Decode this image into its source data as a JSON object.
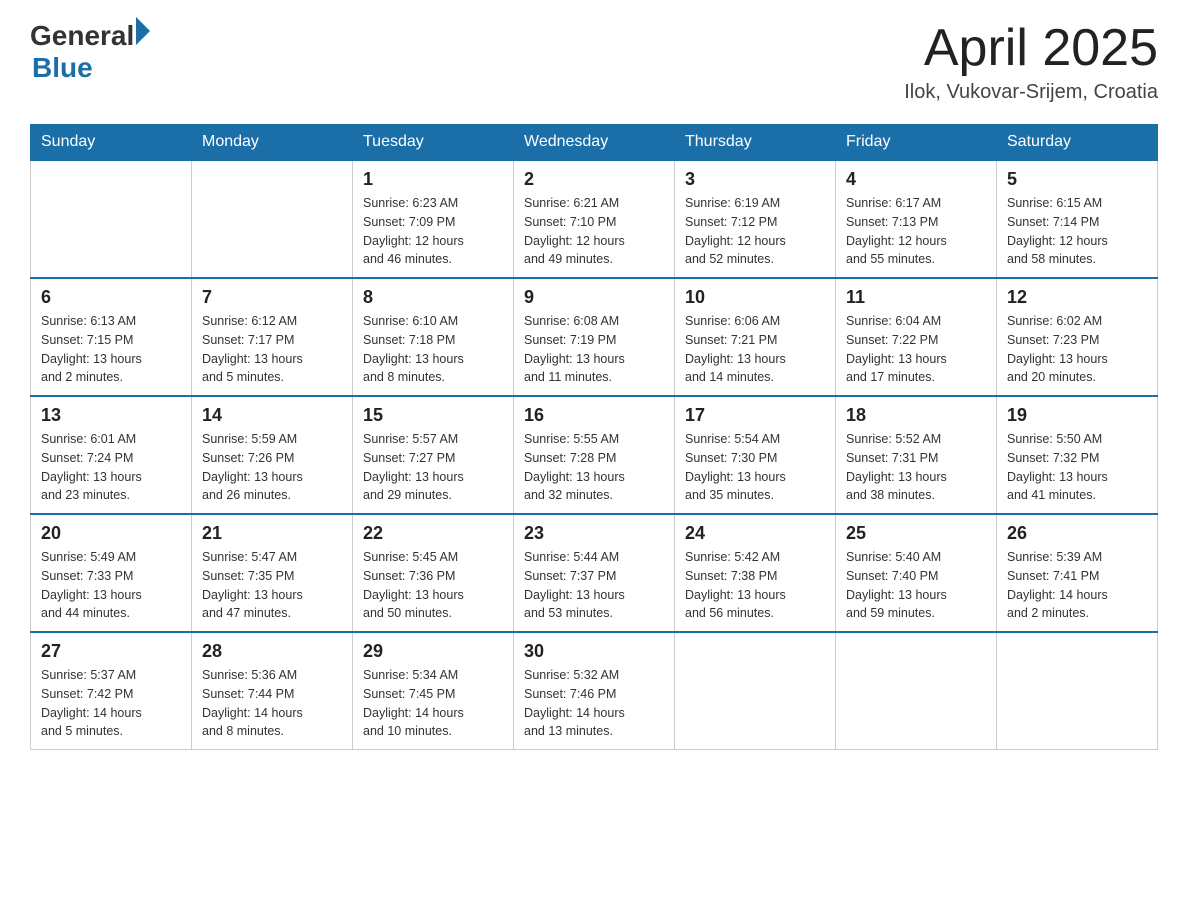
{
  "header": {
    "logo_general": "General",
    "logo_blue": "Blue",
    "title": "April 2025",
    "subtitle": "Ilok, Vukovar-Srijem, Croatia"
  },
  "days_of_week": [
    "Sunday",
    "Monday",
    "Tuesday",
    "Wednesday",
    "Thursday",
    "Friday",
    "Saturday"
  ],
  "weeks": [
    [
      {
        "day": "",
        "info": ""
      },
      {
        "day": "",
        "info": ""
      },
      {
        "day": "1",
        "info": "Sunrise: 6:23 AM\nSunset: 7:09 PM\nDaylight: 12 hours\nand 46 minutes."
      },
      {
        "day": "2",
        "info": "Sunrise: 6:21 AM\nSunset: 7:10 PM\nDaylight: 12 hours\nand 49 minutes."
      },
      {
        "day": "3",
        "info": "Sunrise: 6:19 AM\nSunset: 7:12 PM\nDaylight: 12 hours\nand 52 minutes."
      },
      {
        "day": "4",
        "info": "Sunrise: 6:17 AM\nSunset: 7:13 PM\nDaylight: 12 hours\nand 55 minutes."
      },
      {
        "day": "5",
        "info": "Sunrise: 6:15 AM\nSunset: 7:14 PM\nDaylight: 12 hours\nand 58 minutes."
      }
    ],
    [
      {
        "day": "6",
        "info": "Sunrise: 6:13 AM\nSunset: 7:15 PM\nDaylight: 13 hours\nand 2 minutes."
      },
      {
        "day": "7",
        "info": "Sunrise: 6:12 AM\nSunset: 7:17 PM\nDaylight: 13 hours\nand 5 minutes."
      },
      {
        "day": "8",
        "info": "Sunrise: 6:10 AM\nSunset: 7:18 PM\nDaylight: 13 hours\nand 8 minutes."
      },
      {
        "day": "9",
        "info": "Sunrise: 6:08 AM\nSunset: 7:19 PM\nDaylight: 13 hours\nand 11 minutes."
      },
      {
        "day": "10",
        "info": "Sunrise: 6:06 AM\nSunset: 7:21 PM\nDaylight: 13 hours\nand 14 minutes."
      },
      {
        "day": "11",
        "info": "Sunrise: 6:04 AM\nSunset: 7:22 PM\nDaylight: 13 hours\nand 17 minutes."
      },
      {
        "day": "12",
        "info": "Sunrise: 6:02 AM\nSunset: 7:23 PM\nDaylight: 13 hours\nand 20 minutes."
      }
    ],
    [
      {
        "day": "13",
        "info": "Sunrise: 6:01 AM\nSunset: 7:24 PM\nDaylight: 13 hours\nand 23 minutes."
      },
      {
        "day": "14",
        "info": "Sunrise: 5:59 AM\nSunset: 7:26 PM\nDaylight: 13 hours\nand 26 minutes."
      },
      {
        "day": "15",
        "info": "Sunrise: 5:57 AM\nSunset: 7:27 PM\nDaylight: 13 hours\nand 29 minutes."
      },
      {
        "day": "16",
        "info": "Sunrise: 5:55 AM\nSunset: 7:28 PM\nDaylight: 13 hours\nand 32 minutes."
      },
      {
        "day": "17",
        "info": "Sunrise: 5:54 AM\nSunset: 7:30 PM\nDaylight: 13 hours\nand 35 minutes."
      },
      {
        "day": "18",
        "info": "Sunrise: 5:52 AM\nSunset: 7:31 PM\nDaylight: 13 hours\nand 38 minutes."
      },
      {
        "day": "19",
        "info": "Sunrise: 5:50 AM\nSunset: 7:32 PM\nDaylight: 13 hours\nand 41 minutes."
      }
    ],
    [
      {
        "day": "20",
        "info": "Sunrise: 5:49 AM\nSunset: 7:33 PM\nDaylight: 13 hours\nand 44 minutes."
      },
      {
        "day": "21",
        "info": "Sunrise: 5:47 AM\nSunset: 7:35 PM\nDaylight: 13 hours\nand 47 minutes."
      },
      {
        "day": "22",
        "info": "Sunrise: 5:45 AM\nSunset: 7:36 PM\nDaylight: 13 hours\nand 50 minutes."
      },
      {
        "day": "23",
        "info": "Sunrise: 5:44 AM\nSunset: 7:37 PM\nDaylight: 13 hours\nand 53 minutes."
      },
      {
        "day": "24",
        "info": "Sunrise: 5:42 AM\nSunset: 7:38 PM\nDaylight: 13 hours\nand 56 minutes."
      },
      {
        "day": "25",
        "info": "Sunrise: 5:40 AM\nSunset: 7:40 PM\nDaylight: 13 hours\nand 59 minutes."
      },
      {
        "day": "26",
        "info": "Sunrise: 5:39 AM\nSunset: 7:41 PM\nDaylight: 14 hours\nand 2 minutes."
      }
    ],
    [
      {
        "day": "27",
        "info": "Sunrise: 5:37 AM\nSunset: 7:42 PM\nDaylight: 14 hours\nand 5 minutes."
      },
      {
        "day": "28",
        "info": "Sunrise: 5:36 AM\nSunset: 7:44 PM\nDaylight: 14 hours\nand 8 minutes."
      },
      {
        "day": "29",
        "info": "Sunrise: 5:34 AM\nSunset: 7:45 PM\nDaylight: 14 hours\nand 10 minutes."
      },
      {
        "day": "30",
        "info": "Sunrise: 5:32 AM\nSunset: 7:46 PM\nDaylight: 14 hours\nand 13 minutes."
      },
      {
        "day": "",
        "info": ""
      },
      {
        "day": "",
        "info": ""
      },
      {
        "day": "",
        "info": ""
      }
    ]
  ]
}
